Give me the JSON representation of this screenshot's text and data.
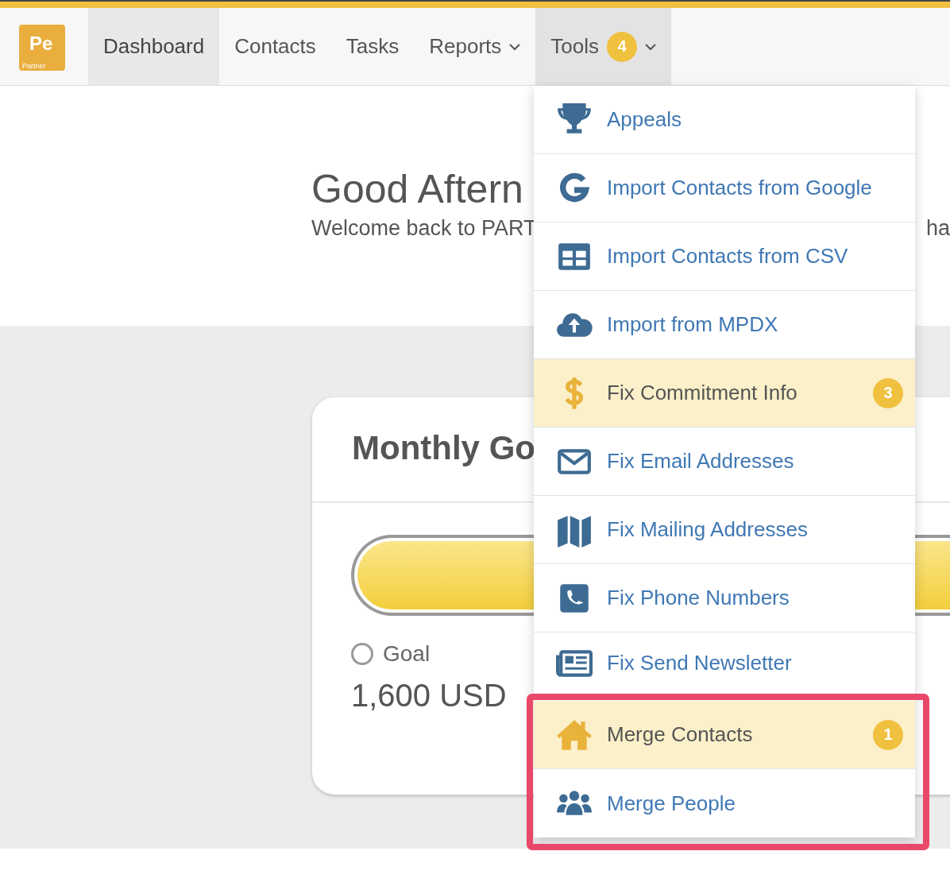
{
  "logo": {
    "text": "Pe",
    "subtext": "Partner"
  },
  "nav": [
    {
      "label": "Dashboard",
      "selected": true,
      "caret": false
    },
    {
      "label": "Contacts",
      "selected": false,
      "caret": false
    },
    {
      "label": "Tasks",
      "selected": false,
      "caret": false
    },
    {
      "label": "Reports",
      "selected": false,
      "caret": true
    },
    {
      "label": "Tools",
      "selected": false,
      "caret": true,
      "badge": "4",
      "expanded": true
    }
  ],
  "hero": {
    "greeting": "Good Aftern",
    "subtitle": "Welcome back to PART",
    "subtitle_tail": "ha"
  },
  "card": {
    "title": "Monthly Go",
    "progress": {
      "level": 1
    },
    "goal": {
      "label": "Goal",
      "selected": false,
      "amount": "1,600 USD"
    }
  },
  "tools_menu": [
    {
      "label": "Appeals",
      "highlighted": false
    },
    {
      "label": "Import Contacts from Google",
      "highlighted": false
    },
    {
      "label": "Import Contacts from CSV",
      "highlighted": false
    },
    {
      "label": "Import from MPDX",
      "highlighted": false
    },
    {
      "label": "Fix Commitment Info",
      "highlighted": true,
      "badge": "3"
    },
    {
      "label": "Fix Email Addresses",
      "highlighted": false
    },
    {
      "label": "Fix Mailing Addresses",
      "highlighted": false
    },
    {
      "label": "Fix Phone Numbers",
      "highlighted": false
    },
    {
      "label": "Fix Send Newsletter",
      "highlighted": false
    },
    {
      "label": "Merge Contacts",
      "highlighted": true,
      "badge": "1"
    },
    {
      "label": "Merge People",
      "highlighted": false
    }
  ],
  "annotation": {
    "kind": "frame",
    "color": "#e8486a"
  }
}
